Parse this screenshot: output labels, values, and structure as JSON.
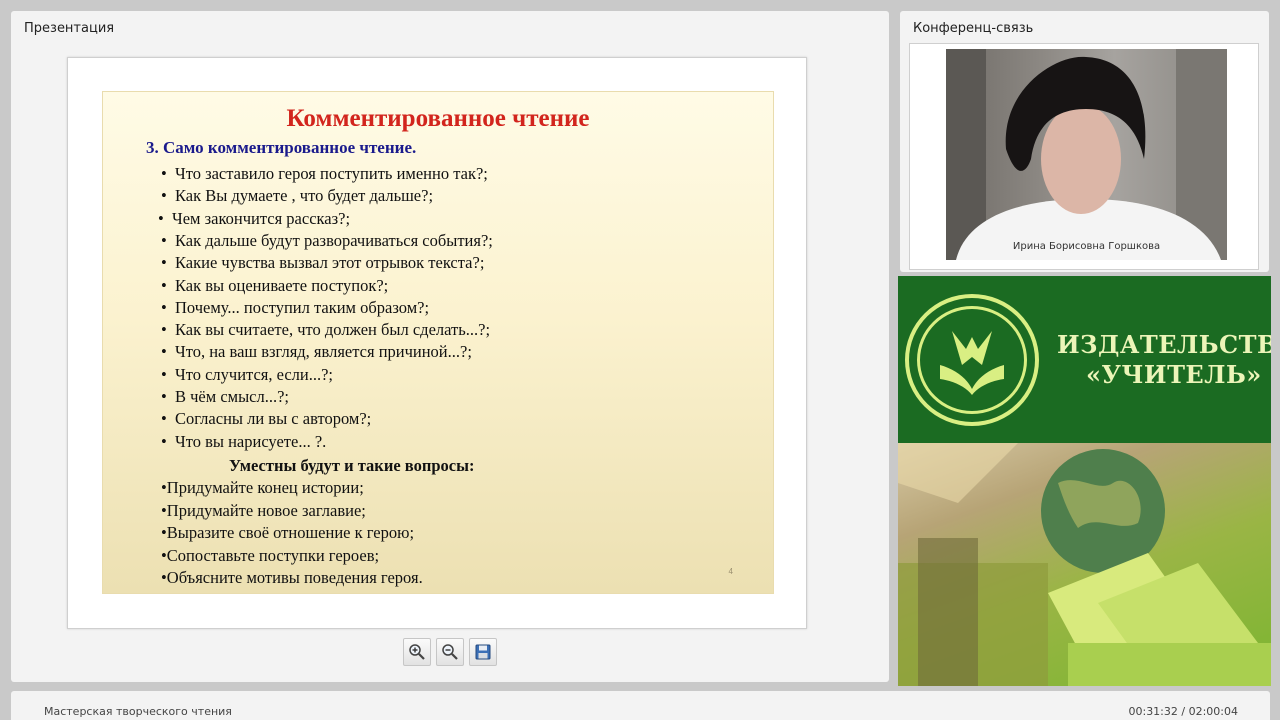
{
  "presentation": {
    "panel_title": "Презентация",
    "slide": {
      "title": "Комментированное чтение",
      "subtitle": "3. Само комментированное чтение.",
      "questions": [
        "Что заставило героя поступить именно так?;",
        "Как Вы думаете , что будет дальше?;",
        "Чем закончится рассказ?;",
        "Как дальше будут разворачиваться события?;",
        "Какие чувства вызвал этот отрывок текста?;",
        "Как вы оцениваете поступок?;",
        "Почему... поступил таким образом?;",
        "Как вы считаете, что должен был сделать...?;",
        "Что, на ваш взгляд, является причиной...?;",
        "Что случится, если...?;",
        "В чём смысл...?;",
        "Согласны ли вы с автором?;",
        "Что вы нарисуете... ?."
      ],
      "section2_title": "Уместны будут и такие вопросы:",
      "tasks": [
        "Придумайте конец истории;",
        "Придумайте новое заглавие;",
        "Выразите своё отношение к герою;",
        "Сопоставьте поступки героев;",
        "Объясните мотивы поведения героя."
      ],
      "page_number": "4"
    },
    "toolbar": {
      "zoom_in_icon": "zoom-in-icon",
      "zoom_out_icon": "zoom-out-icon",
      "save_icon": "floppy-disk-icon"
    }
  },
  "conference": {
    "panel_title": "Конференц-связь",
    "presenter_name": "Ирина Борисовна Горшкова"
  },
  "ad": {
    "publisher_line1": "ИЗДАТЕЛЬСТВО",
    "publisher_line2": "«УЧИТЕЛЬ»",
    "colors": {
      "green": "#1b6b22",
      "light": "#d9ef83"
    }
  },
  "footer": {
    "title": "Мастерская творческого чтения",
    "time": "00:31:32 / 02:00:04"
  }
}
